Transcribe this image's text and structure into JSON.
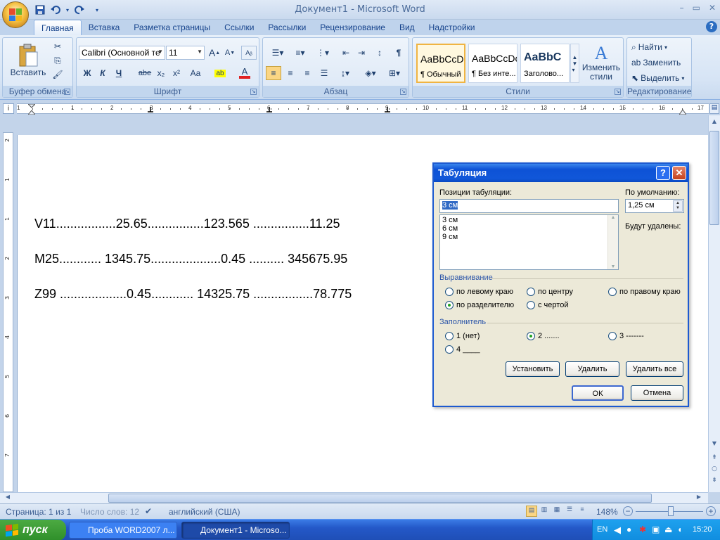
{
  "window": {
    "title": "Документ1 - Microsoft Word",
    "controls": [
      "–",
      "▭",
      "✕"
    ]
  },
  "qat": {
    "save": "💾",
    "undo": "↶",
    "redo": "↺",
    "more": "▾"
  },
  "tabs": [
    "Главная",
    "Вставка",
    "Разметка страницы",
    "Ссылки",
    "Рассылки",
    "Рецензирование",
    "Вид",
    "Надстройки"
  ],
  "help": "?",
  "ribbon": {
    "clipboard": {
      "label": "Буфер обмена",
      "paste": "Вставить"
    },
    "font": {
      "label": "Шрифт",
      "font_name": "Calibri (Основной те",
      "font_size": "11",
      "bold": "Ж",
      "italic": "К",
      "underline": "Ч",
      "strike": "abe",
      "sub": "x₂",
      "sup": "x²",
      "case": "Aa"
    },
    "paragraph": {
      "label": "Абзац"
    },
    "styles": {
      "label": "Стили",
      "change": "Изменить стили",
      "items": [
        {
          "sample": "AaBbCcDc",
          "name": "¶ Обычный"
        },
        {
          "sample": "AaBbCcDc",
          "name": "¶ Без инте..."
        },
        {
          "sample": "AaBbC",
          "name": "Заголово..."
        }
      ]
    },
    "editing": {
      "label": "Редактирование",
      "find": "Найти",
      "replace": "Заменить",
      "select": "Выделить"
    }
  },
  "ruler": {
    "corner": "i",
    "numbers": [
      "1",
      "1",
      "2",
      "3",
      "4",
      "5",
      "6",
      "7",
      "8",
      "9",
      "10",
      "11",
      "12",
      "13",
      "14",
      "15",
      "16",
      "17"
    ]
  },
  "document": {
    "lines": [
      "V11.................25.65................123.565 ................11.25",
      "M25............ 1345.75....................0.45 .......... 345675.95",
      "Z99 ...................0.45............ 14325.75 .................78.775"
    ]
  },
  "dialog": {
    "title": "Табуляция",
    "help": "?",
    "close": "✕",
    "positions_label": "Позиции табуляции:",
    "position_value": "3 см",
    "position_list": [
      "3 см",
      "6 см",
      "9 см"
    ],
    "default_label": "По умолчанию:",
    "default_value": "1,25 см",
    "to_delete_label": "Будут удалены:",
    "alignment_label": "Выравнивание",
    "alignment": {
      "left": "по левому краю",
      "center": "по центру",
      "right": "по правому краю",
      "decimal": "по разделителю",
      "bar": "с чертой"
    },
    "leader_label": "Заполнитель",
    "leader": {
      "none": "1 (нет)",
      "dots": "2 .......",
      "dashes": "3 -------",
      "line": "4 ____"
    },
    "buttons": {
      "set": "Установить",
      "clear": "Удалить",
      "clear_all": "Удалить все",
      "ok": "ОК",
      "cancel": "Отмена"
    }
  },
  "status": {
    "page": "Страница: 1 из 1",
    "words": "Число слов: 12",
    "language": "английский (США)",
    "zoom": "148%"
  },
  "taskbar": {
    "start": "пуск",
    "tasks": [
      "Проба WORD2007 л...",
      "Документ1 - Microso..."
    ],
    "lang": "EN",
    "time": "15:20"
  }
}
